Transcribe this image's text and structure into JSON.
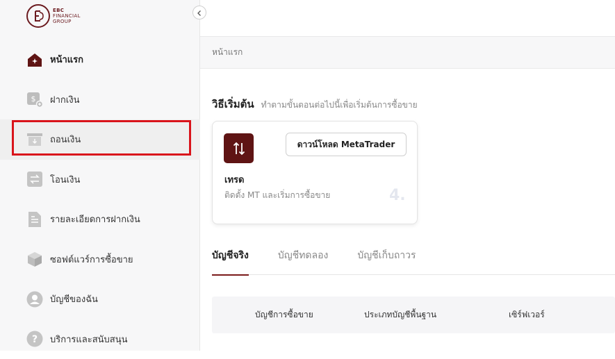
{
  "logo": {
    "line1": "EBC",
    "line2": "FINANCIAL",
    "line3": "GROUP",
    "brand_color": "#6b1a1f"
  },
  "sidebar": {
    "items": [
      {
        "label": "หน้าแรก",
        "icon": "home-icon",
        "active": true
      },
      {
        "label": "ฝากเงิน",
        "icon": "deposit-icon"
      },
      {
        "label": "ถอนเงิน",
        "icon": "withdraw-icon",
        "highlighted": true
      },
      {
        "label": "โอนเงิน",
        "icon": "transfer-icon"
      },
      {
        "label": "รายละเอียดการฝากเงิน",
        "icon": "document-icon"
      },
      {
        "label": "ซอฟต์แวร์การซื้อขาย",
        "icon": "box-icon"
      },
      {
        "label": "บัญชีของฉัน",
        "icon": "user-icon"
      },
      {
        "label": "บริการและสนับสนุน",
        "icon": "help-icon"
      }
    ]
  },
  "breadcrumb": {
    "current": "หน้าแรก"
  },
  "howto": {
    "title": "วิธีเริ่มต้น",
    "subtitle": "ทำตามขั้นตอนต่อไปนี้เพื่อเริ่มต้นการซื้อขาย"
  },
  "card": {
    "icon": "trade-arrows-icon",
    "button_label": "ดาวน์โหลด MetaTrader",
    "title": "เทรด",
    "description": "ติดตั้ง MT และเริ่มการซื้อขาย",
    "step": "4."
  },
  "tabs": [
    {
      "label": "บัญชีจริง",
      "active": true
    },
    {
      "label": "บัญชีทดลอง"
    },
    {
      "label": "บัญชีเก็บถาวร"
    }
  ],
  "table": {
    "headers": [
      "บัญชีการซื้อขาย",
      "ประเภทบัญชีพื้นฐาน",
      "เซิร์ฟเวอร์"
    ]
  },
  "colors": {
    "accent": "#6b1a1f",
    "highlight_border": "#d9141b"
  }
}
